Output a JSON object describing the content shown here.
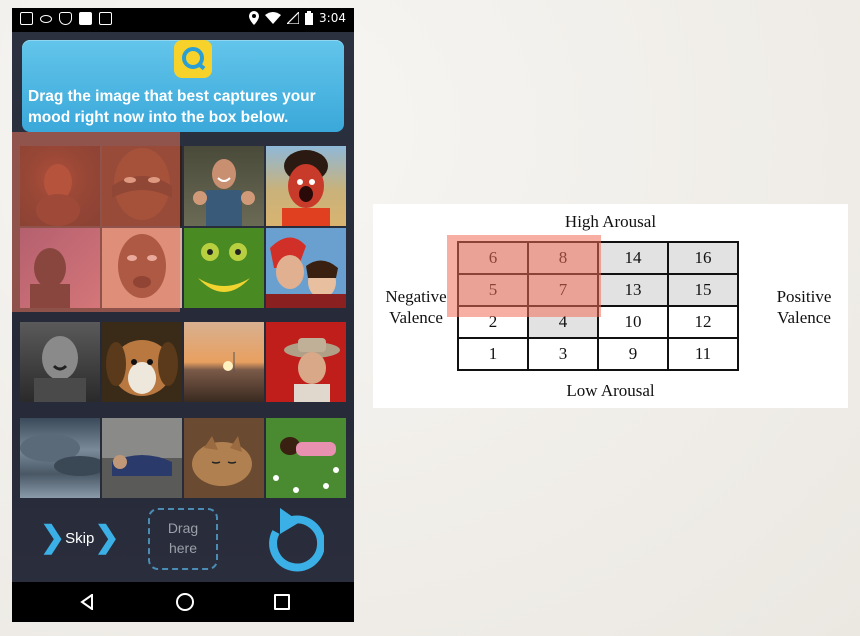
{
  "status_bar": {
    "time": "3:04"
  },
  "banner": {
    "instruction": "Drag the image that best captures your mood right now into the box below."
  },
  "controls": {
    "skip_label": "Skip",
    "drop_box_label": "Drag here"
  },
  "photo_grid": {
    "rows": [
      [
        "dark red portrait",
        "hands over eyes",
        "thumbs up man",
        "screaming face paint"
      ],
      [
        "shadow scream",
        "angry man",
        "grass smiley face",
        "party couple"
      ],
      [
        "crying boy",
        "sad puppy",
        "sunset lake",
        "cowboy hat man"
      ],
      [
        "storm clouds",
        "sleeping on bench",
        "sleeping kitten",
        "lying in flowers"
      ]
    ]
  },
  "diagram": {
    "top_label": "High Arousal",
    "bottom_label": "Low Arousal",
    "left_label": [
      "Negative",
      "Valence"
    ],
    "right_label": [
      "Positive",
      "Valence"
    ],
    "cells": [
      [
        "6",
        "8",
        "14",
        "16"
      ],
      [
        "5",
        "7",
        "13",
        "15"
      ],
      [
        "2",
        "4",
        "10",
        "12"
      ],
      [
        "1",
        "3",
        "9",
        "11"
      ]
    ]
  },
  "colors": {
    "accent": "#3bb0e6",
    "highlight": "#e5735a",
    "banner": "#4ab5e2",
    "logo": "#f6d22a"
  }
}
